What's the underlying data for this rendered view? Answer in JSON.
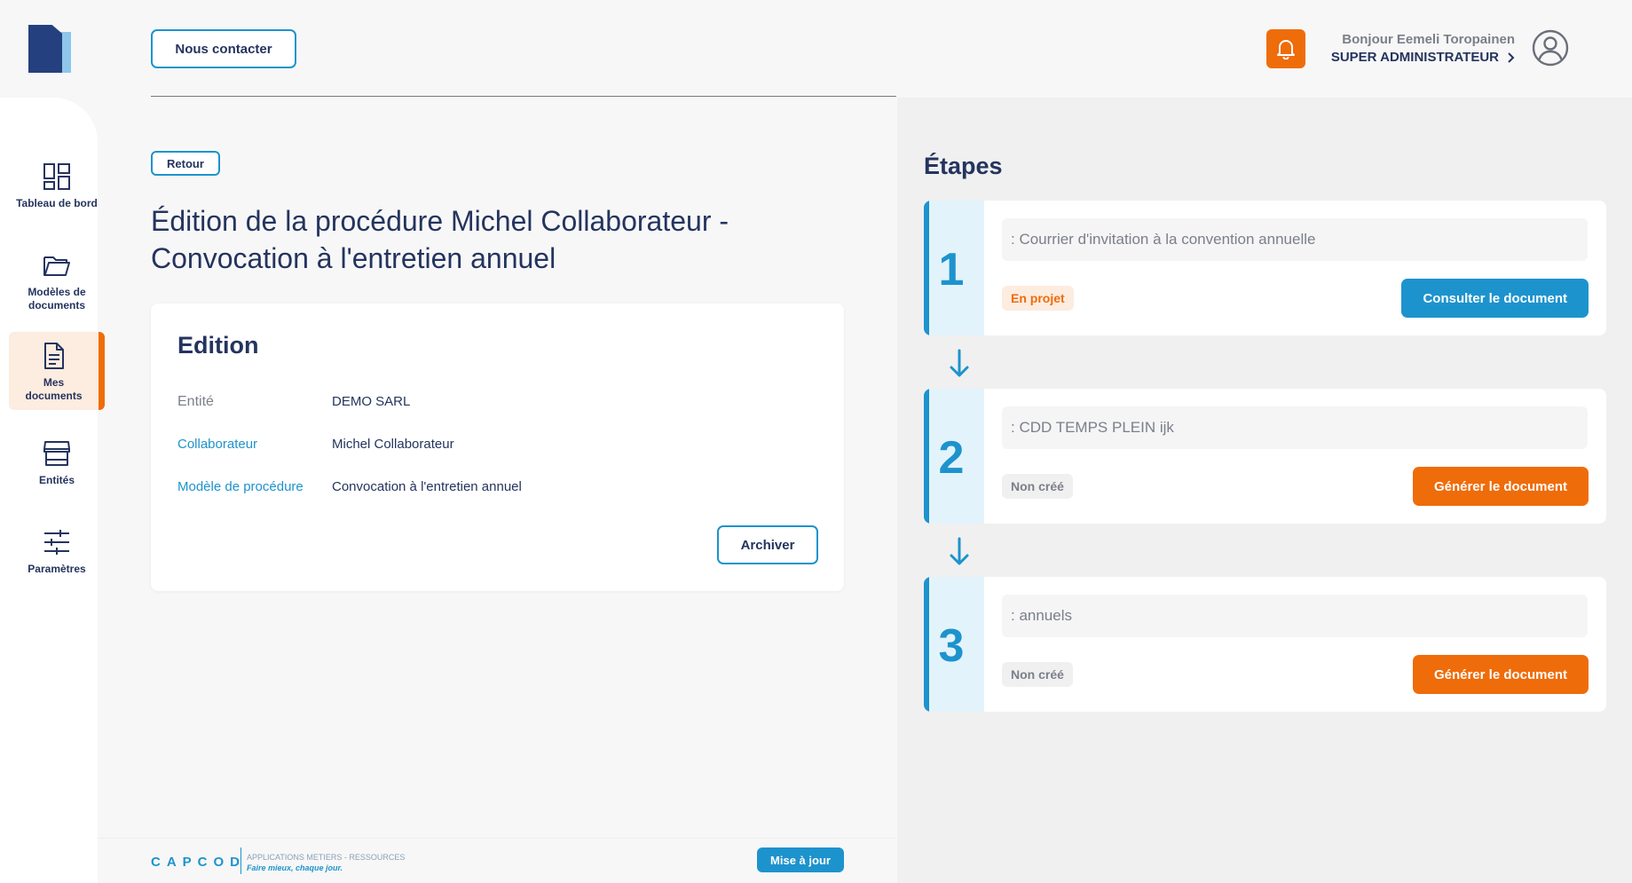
{
  "header": {
    "contact_label": "Nous contacter",
    "greeting": "Bonjour Eemeli Toropainen",
    "role": "SUPER ADMINISTRATEUR"
  },
  "sidebar": {
    "items": [
      {
        "label": "Tableau de bord",
        "icon": "dashboard-icon"
      },
      {
        "label": "Modèles de documents",
        "icon": "folder-icon"
      },
      {
        "label": "Mes documents",
        "icon": "document-icon",
        "active": true
      },
      {
        "label": "Entités",
        "icon": "store-icon"
      },
      {
        "label": "Paramètres",
        "icon": "sliders-icon"
      }
    ]
  },
  "main": {
    "back_label": "Retour",
    "title": "Édition de la procédure Michel Collaborateur - Convocation à l'entretien annuel",
    "card": {
      "title": "Edition",
      "fields": [
        {
          "label": "Entité",
          "value": "DEMO SARL"
        },
        {
          "label": "Collaborateur",
          "value": "Michel Collaborateur"
        },
        {
          "label": "Modèle de procédure",
          "value": "Convocation à l'entretien annuel"
        }
      ],
      "archive_label": "Archiver"
    }
  },
  "footer": {
    "brand": "CAPCOD",
    "tagline1": "APPLICATIONS METIERS - RESSOURCES",
    "tagline2": "Faire mieux, chaque jour.",
    "update_label": "Mise à jour"
  },
  "steps_panel": {
    "title": "Étapes",
    "steps": [
      {
        "number": "1",
        "name": ": Courrier d'invitation à la convention annuelle",
        "status": "En projet",
        "action": "Consulter le document"
      },
      {
        "number": "2",
        "name": ": CDD TEMPS PLEIN ijk",
        "status": "Non créé",
        "action": "Générer le document"
      },
      {
        "number": "3",
        "name": ": annuels",
        "status": "Non créé",
        "action": "Générer le document"
      }
    ]
  },
  "colors": {
    "primary": "#1d93cd",
    "accent": "#ef6c0a",
    "text": "#24345e"
  }
}
